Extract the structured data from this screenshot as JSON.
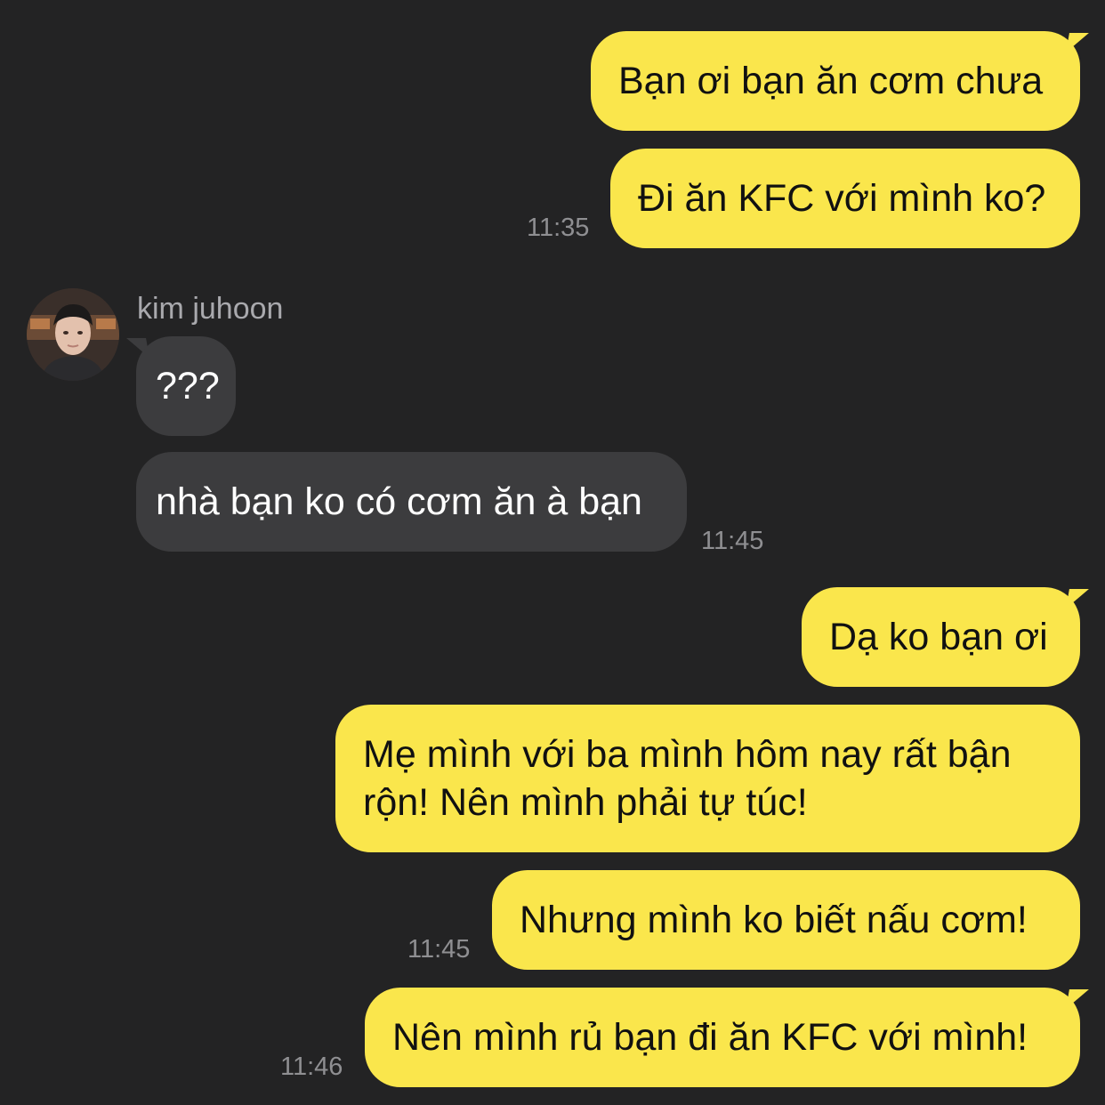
{
  "messages": [
    {
      "dir": "out",
      "text": "Bạn ơi bạn ăn cơm chưa"
    },
    {
      "dir": "out",
      "text": "Đi ăn KFC với mình ko?",
      "time": "11:35"
    },
    {
      "dir": "in",
      "sender": "kim juhoon",
      "text": "???"
    },
    {
      "dir": "in",
      "text": "nhà bạn ko có cơm ăn à bạn",
      "time": "11:45"
    },
    {
      "dir": "out",
      "text": "Dạ ko bạn ơi"
    },
    {
      "dir": "out",
      "lines": [
        "Mẹ mình với ba mình hôm nay rất bận",
        "rộn! Nên mình phải tự túc!"
      ]
    },
    {
      "dir": "out",
      "text": "Nhưng mình ko biết nấu cơm!",
      "time": "11:45"
    },
    {
      "dir": "out",
      "text": "Nên mình rủ bạn đi ăn KFC với mình!",
      "time": "11:46"
    }
  ],
  "colors": {
    "background": "#232324",
    "outgoing_bubble": "#fae64c",
    "incoming_bubble": "#3c3c3e",
    "timestamp": "#8f8f92"
  },
  "icons": {
    "avatar": "profile-photo"
  }
}
